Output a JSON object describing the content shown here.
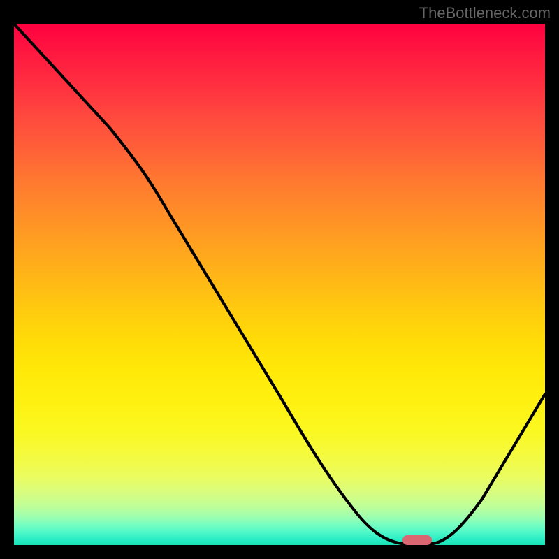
{
  "watermark": "TheBottleneck.com",
  "chart_data": {
    "type": "line",
    "title": "",
    "xlabel": "",
    "ylabel": "",
    "xlim": [
      0,
      100
    ],
    "ylim": [
      0,
      100
    ],
    "series": [
      {
        "name": "bottleneck-curve",
        "x": [
          0,
          18,
          25,
          35,
          45,
          55,
          62,
          67,
          72,
          76,
          80,
          88,
          100
        ],
        "values": [
          100,
          80,
          71,
          56,
          41,
          26,
          15,
          7,
          1,
          0,
          0,
          12,
          33
        ]
      }
    ],
    "optimal_marker_x": 78,
    "colors": {
      "top": "#ff0040",
      "bottom": "#18e2b8",
      "curve": "#000000",
      "marker": "#d96670"
    }
  }
}
